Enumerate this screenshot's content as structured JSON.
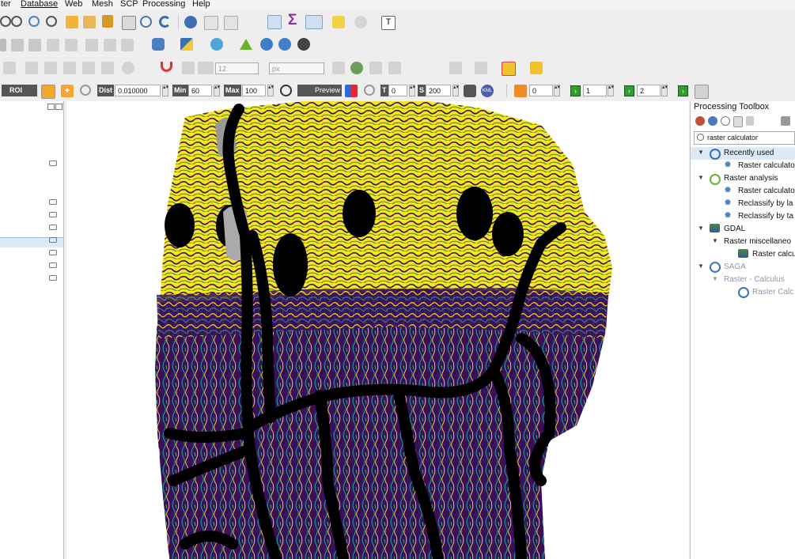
{
  "menubar": {
    "items": [
      "ter",
      "Database",
      "Web",
      "Mesh",
      "SCP",
      "Processing",
      "Help"
    ]
  },
  "toolbar3": {
    "size_value": "12",
    "unit_value": "px"
  },
  "scp_toolbar": {
    "roi_label": "ROI",
    "dist_label": "Dist",
    "dist_value": "0.010000",
    "min_label": "Min",
    "min_value": "60",
    "max_label": "Max",
    "max_value": "100",
    "preview_label": "Preview",
    "t_label": "T",
    "t_value": "0",
    "s_label": "S",
    "s_value": "200",
    "band1_value": "0",
    "band2_value": "1",
    "band3_value": "2"
  },
  "toolbox": {
    "title": "Processing Toolbox",
    "search_value": "raster calculator",
    "tree": [
      {
        "label": "Recently used",
        "level": 0,
        "muted": false,
        "icon": "clock-icon"
      },
      {
        "label": "Raster calculato",
        "level": 1,
        "muted": false,
        "icon": "gear-icon"
      },
      {
        "label": "Raster analysis",
        "level": 0,
        "muted": false,
        "icon": "qgis-icon"
      },
      {
        "label": "Raster calculato",
        "level": 1,
        "muted": false,
        "icon": "gear-icon"
      },
      {
        "label": "Reclassify by la",
        "level": 1,
        "muted": false,
        "icon": "gear-icon"
      },
      {
        "label": "Reclassify by ta",
        "level": 1,
        "muted": false,
        "icon": "gear-icon"
      },
      {
        "label": "GDAL",
        "level": 0,
        "muted": false,
        "icon": "gdal-icon"
      },
      {
        "label": "Raster miscellaneo",
        "level": 1,
        "muted": false,
        "icon": ""
      },
      {
        "label": "Raster calcu",
        "level": 2,
        "muted": false,
        "icon": "gdal-icon"
      },
      {
        "label": "SAGA",
        "level": 0,
        "muted": true,
        "icon": "saga-icon"
      },
      {
        "label": "Raster - Calculus",
        "level": 1,
        "muted": true,
        "icon": ""
      },
      {
        "label": "Raster Calc",
        "level": 2,
        "muted": true,
        "icon": "saga-icon"
      }
    ]
  },
  "colors": {
    "raster_yellow": "#f5e71a",
    "raster_purple": "#3b0f5c",
    "raster_teal": "#21918c",
    "raster_green": "#52c569",
    "mask_black": "#000000",
    "accent_blue": "#4f84c4"
  }
}
